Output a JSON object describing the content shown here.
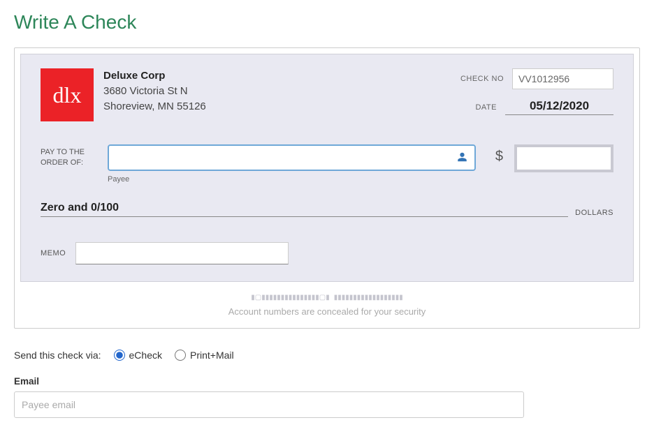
{
  "page_title": "Write A Check",
  "company": {
    "logo_text": "dlx",
    "name": "Deluxe Corp",
    "address1": "3680 Victoria St N",
    "address2": "Shoreview, MN 55126"
  },
  "check": {
    "checkno_label": "CHECK NO",
    "checkno_value": "VV1012956",
    "date_label": "DATE",
    "date_value": "05/12/2020",
    "payto_label": "PAY TO THE ORDER OF:",
    "payee_value": "",
    "payee_hint": "Payee",
    "dollar_sign": "$",
    "amount_value": "",
    "amount_words": "Zero and 0/100",
    "dollars_label": "DOLLARS",
    "memo_label": "MEMO",
    "memo_value": ""
  },
  "footer": {
    "micr_pattern": "▮▢▮▮▮▮▮▮▮▮▮▮▮▮▮▮▮▢▮  ▮▮▮▮▮▮▮▮▮▮▮▮▮▮▮▮▮▮",
    "concealed_text": "Account numbers are concealed for your security"
  },
  "send": {
    "label": "Send this check via:",
    "echeck_label": "eCheck",
    "printmail_label": "Print+Mail",
    "selected": "echeck"
  },
  "email": {
    "label": "Email",
    "placeholder": "Payee email",
    "value": ""
  }
}
